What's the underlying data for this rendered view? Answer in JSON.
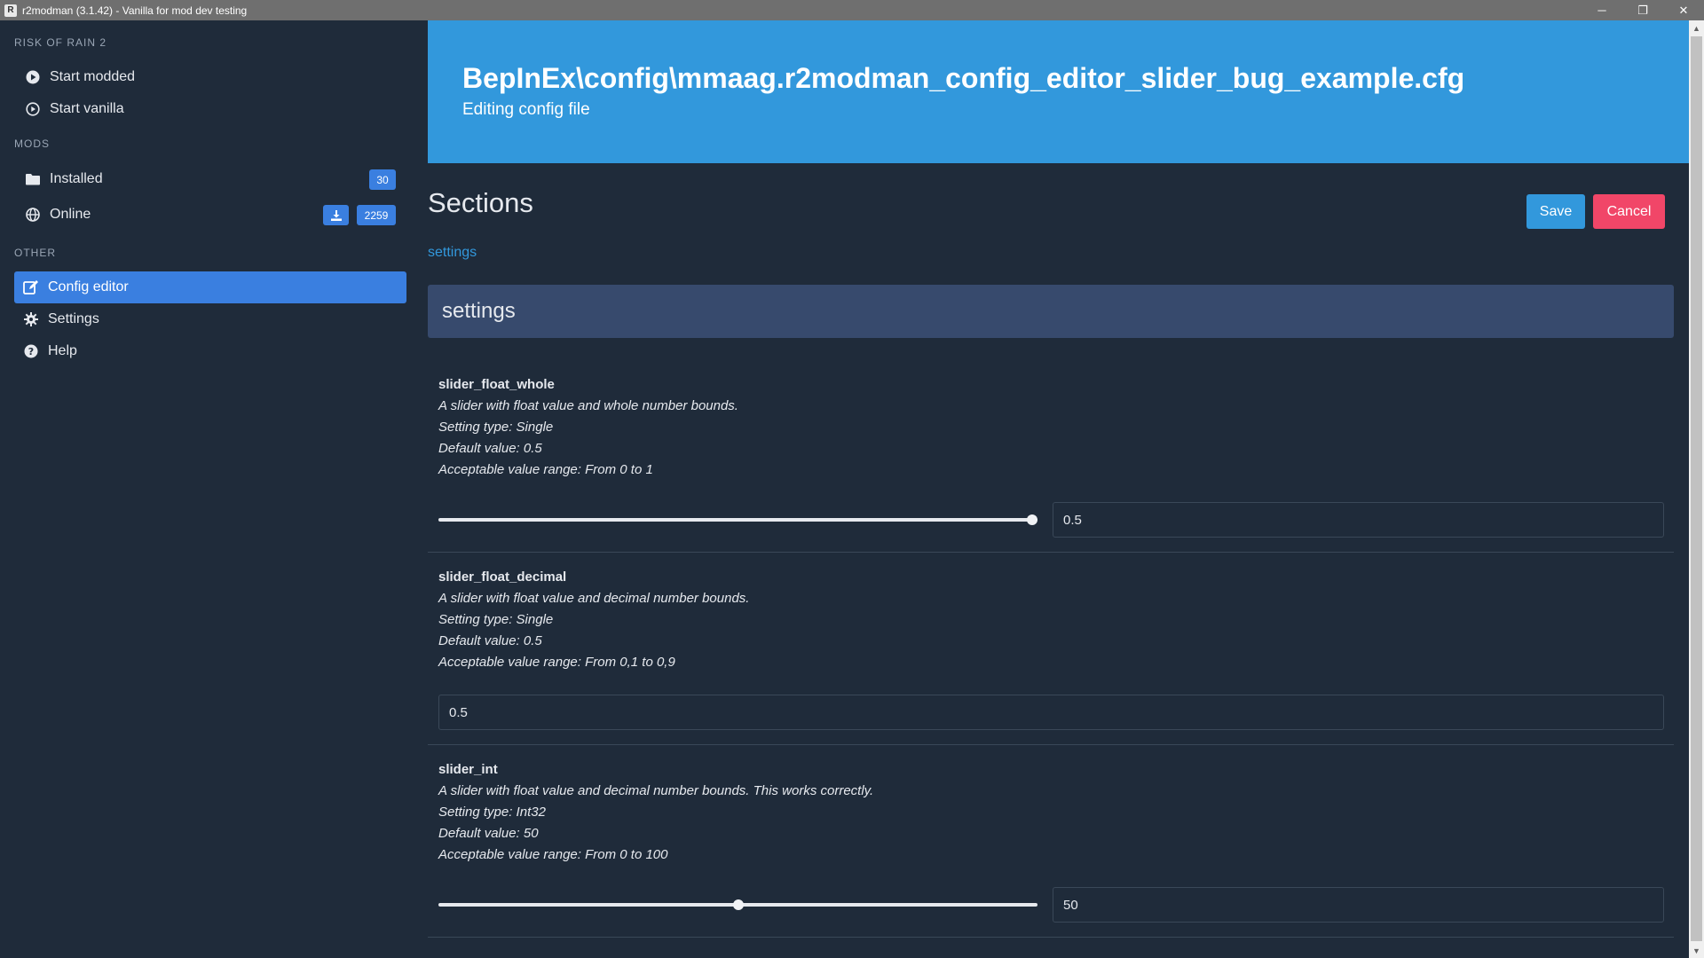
{
  "window": {
    "app_icon": "R",
    "title": "r2modman (3.1.42) - Vanilla for mod dev testing",
    "minimize_glyph": "─",
    "restore_glyph": "❐",
    "close_glyph": "✕"
  },
  "sidebar": {
    "game_label": "RISK OF RAIN 2",
    "start_modded": "Start modded",
    "start_vanilla": "Start vanilla",
    "mods_label": "MODS",
    "installed": "Installed",
    "installed_count": "30",
    "online": "Online",
    "online_count": "2259",
    "other_label": "OTHER",
    "config_editor": "Config editor",
    "settings": "Settings",
    "help": "Help"
  },
  "hero": {
    "title": "BepInEx\\config\\mmaag.r2modman_config_editor_slider_bug_example.cfg",
    "subtitle": "Editing config file"
  },
  "content": {
    "sections_title": "Sections",
    "save": "Save",
    "cancel": "Cancel",
    "section_link": "settings",
    "section_header": "settings"
  },
  "settings": [
    {
      "name": "slider_float_whole",
      "description": "A slider with float value and whole number bounds.",
      "type": "Setting type: Single",
      "default": "Default value: 0.5",
      "range": "Acceptable value range: From 0 to 1",
      "value": "0.5",
      "slider_fraction": 1.0
    },
    {
      "name": "slider_float_decimal",
      "description": "A slider with float value and decimal number bounds.",
      "type": "Setting type: Single",
      "default": "Default value: 0.5",
      "range": "Acceptable value range: From 0,1 to 0,9",
      "value": "0.5"
    },
    {
      "name": "slider_int",
      "description": "A slider with float value and decimal number bounds. This works correctly.",
      "type": "Setting type: Int32",
      "default": "Default value: 50",
      "range": "Acceptable value range: From 0 to 100",
      "value": "50",
      "slider_fraction": 0.5
    }
  ],
  "colors": {
    "background": "#1f2b3a",
    "accent": "#3298dc",
    "active": "#3a7fe0",
    "danger": "#f14668",
    "section_header": "#374a6d"
  }
}
